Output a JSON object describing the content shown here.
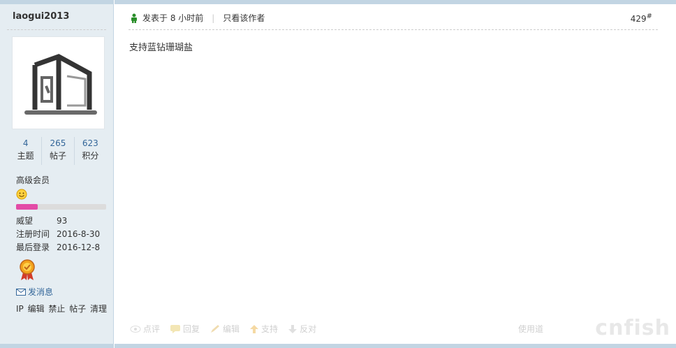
{
  "author": {
    "username": "laogui2013",
    "stats": [
      {
        "num": "4",
        "label": "主题"
      },
      {
        "num": "265",
        "label": "帖子"
      },
      {
        "num": "623",
        "label": "积分"
      }
    ],
    "group": "高级会员",
    "progress_fraction": 0.24,
    "fields": [
      {
        "k": "威望",
        "v": "93"
      },
      {
        "k": "注册时间",
        "v": "2016-8-30"
      },
      {
        "k": "最后登录",
        "v": "2016-12-8"
      }
    ],
    "pm_label": "发消息",
    "admin_links": "IP 编辑 禁止 帖子 清理"
  },
  "post": {
    "posted_at": "发表于 8 小时前",
    "only_author": "只看该作者",
    "floor": "429",
    "floor_sup": "#",
    "content": "支持蓝钻珊瑚盐",
    "actions": [
      {
        "label": "点评",
        "icon": "eye-icon"
      },
      {
        "label": "回复",
        "icon": "reply-icon"
      },
      {
        "label": "编辑",
        "icon": "pencil-icon"
      },
      {
        "label": "支持",
        "icon": "up-arrow-icon"
      },
      {
        "label": "反对",
        "icon": "down-arrow-icon"
      }
    ],
    "use_label": "使用道",
    "watermark": "cnfish"
  },
  "colors": {
    "accent": "#336699",
    "sidebar_bg": "#e5edf2",
    "border": "#c2d5e3",
    "progress": "#e34ba6"
  }
}
